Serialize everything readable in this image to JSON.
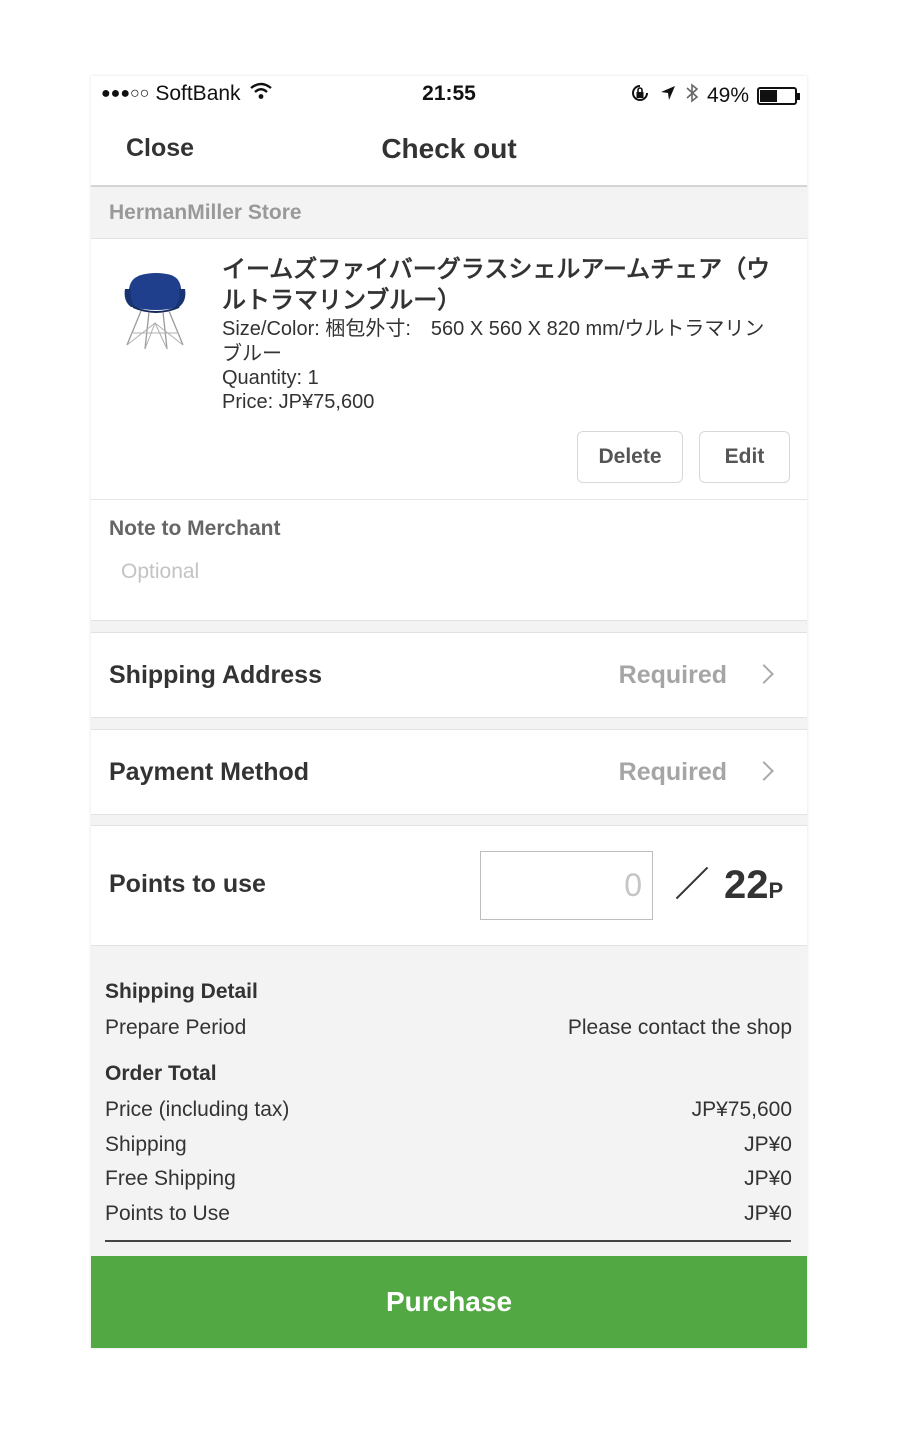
{
  "status_bar": {
    "signal": "●●●○○",
    "carrier": "SoftBank",
    "time": "21:55",
    "battery": "49%",
    "battery_level": 0.49
  },
  "nav": {
    "close": "Close",
    "title": "Check out"
  },
  "store": {
    "name": "HermanMiller Store"
  },
  "product": {
    "title": "イームズファイバーグラスシェルアームチェア（ウルトラマリンブルー）",
    "size_color": "Size/Color: 梱包外寸:　560 X 560 X 820 mm/ウルトラマリンブルー",
    "quantity": "Quantity: 1",
    "price": "Price: JP¥75,600",
    "delete": "Delete",
    "edit": "Edit"
  },
  "note": {
    "label": "Note to Merchant",
    "placeholder": "Optional"
  },
  "shipping_address": {
    "label": "Shipping Address",
    "value": "Required"
  },
  "payment_method": {
    "label": "Payment Method",
    "value": "Required"
  },
  "points": {
    "label": "Points to use",
    "placeholder": "0",
    "total": "22",
    "unit": "P"
  },
  "summary": {
    "shipping_detail": "Shipping Detail",
    "prepare_period_label": "Prepare Period",
    "prepare_period_value": "Please contact the shop",
    "order_total": "Order Total",
    "lines": [
      {
        "label": "Price (including tax)",
        "value": "JP¥75,600"
      },
      {
        "label": "Shipping",
        "value": "JP¥0"
      },
      {
        "label": "Free Shipping",
        "value": "JP¥0"
      },
      {
        "label": "Points to Use",
        "value": "JP¥0"
      }
    ]
  },
  "purchase": "Purchase",
  "colors": {
    "accent": "#52a843",
    "chair": "#1f3f8c"
  }
}
